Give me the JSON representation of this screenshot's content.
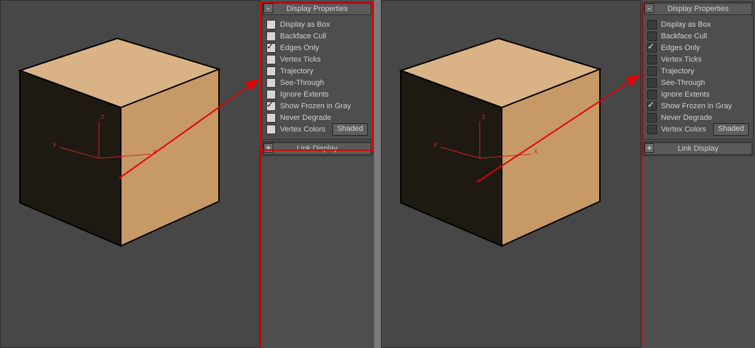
{
  "panels": {
    "display_properties": {
      "title": "Display Properties",
      "collapse_glyph": "-",
      "options": [
        {
          "label": "Display as Box",
          "checked": false
        },
        {
          "label": "Backface Cull",
          "checked": false
        },
        {
          "label": "Edges Only",
          "checked": true
        },
        {
          "label": "Vertex Ticks",
          "checked": false
        },
        {
          "label": "Trajectory",
          "checked": false
        },
        {
          "label": "See-Through",
          "checked": false
        },
        {
          "label": "Ignore Extents",
          "checked": false
        },
        {
          "label": "Show Frozen in Gray",
          "checked": true
        },
        {
          "label": "Never Degrade",
          "checked": false
        },
        {
          "label": "Vertex Colors",
          "checked": false
        }
      ],
      "shaded_button": "Shaded"
    },
    "link_display": {
      "title": "Link Display",
      "collapse_glyph": "+"
    }
  },
  "axes": {
    "x": "x",
    "y": "y",
    "z": "z"
  },
  "variants": {
    "left": {
      "checkbox_style": "light",
      "panel_highlight": true
    },
    "right": {
      "checkbox_style": "dark",
      "panel_highlight": false
    }
  }
}
